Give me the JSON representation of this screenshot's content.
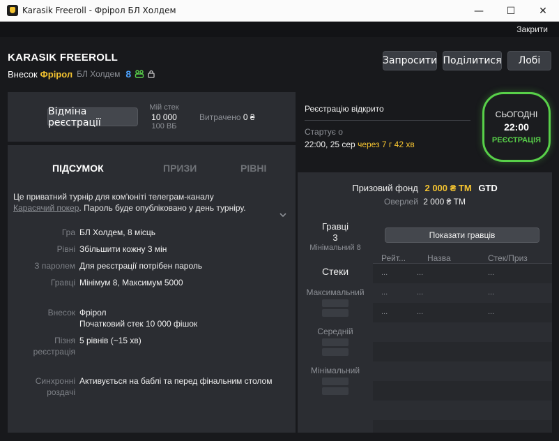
{
  "window": {
    "title": "Karasik Freeroll - Фрірол БЛ Холдем",
    "minimize": "—",
    "maximize": "☐",
    "close": "✕"
  },
  "closebar": {
    "label": "Закрити"
  },
  "header": {
    "title": "KARASIK FREEROLL",
    "buyin_label": "Внесок",
    "buyin_value": "Фрірол",
    "game": "БЛ Холдем",
    "players_count": "8",
    "buttons": {
      "invite": "Запросити",
      "share": "Поділитися",
      "lobby": "Лобі"
    }
  },
  "registration": {
    "cancel_button": "Відміна реєстрації",
    "my_stack_label": "Мій стек",
    "my_stack_value": "10 000",
    "my_stack_bb": "100 ВБ",
    "spent_label": "Витрачено",
    "spent_value": "0 ₴"
  },
  "summary": {
    "tabs": [
      "ПІДСУМОК",
      "ПРИЗИ",
      "РІВНІ"
    ],
    "desc_1": "Це приватний турнір для ком'юніті телеграм-каналу",
    "desc_link": "Карасячий покер",
    "desc_2": ". Пароль буде опубліковано у день турніру.",
    "rows": [
      {
        "key": "Гра",
        "value": "БЛ Холдем, 8 місць"
      },
      {
        "key": "Рівні",
        "value": "Збільшити кожну 3 мін"
      },
      {
        "key": "З паролем",
        "value": "Для реєстрації потрібен пароль"
      },
      {
        "key": "Гравці",
        "value": "Мінімум 8, Максимум 5000"
      },
      {
        "key": "Внесок",
        "value": "Фрірол",
        "value2": "Початковий стек 10 000 фішок"
      },
      {
        "key": "Пізня",
        "key2": "реєстрація",
        "value": "5 рівнів (~15 хв)"
      },
      {
        "key": "Синхронні",
        "key2": "роздачі",
        "value": "Активується на баблі та перед фінальним столом"
      }
    ]
  },
  "status": {
    "reg_open": "Реєстрацію відкрито",
    "starts_label": "Стартує о",
    "start_date": "22:00, 25 сер",
    "start_in": "через 7 г 42 хв",
    "badge_day": "СЬОГОДНІ",
    "badge_time": "22:00",
    "badge_state": "РЕЄСТРАЦІЯ"
  },
  "prize": {
    "fund_label": "Призовий фонд",
    "fund_value": "2 000 ₴ TM",
    "gtd": "GTD",
    "overlay_label": "Оверлей",
    "overlay_value": "2 000 ₴ TM",
    "players_label": "Гравці",
    "players_value": "3",
    "players_min": "Мінімальний 8",
    "stacks_label": "Стеки",
    "stack_max": "Максимальний",
    "stack_avg": "Середній",
    "stack_min": "Мінімальний",
    "show_players": "Показати гравців",
    "columns": [
      "Рейт...",
      "Назва",
      "Стек/Приз"
    ],
    "rows": [
      [
        "...",
        "...",
        "..."
      ],
      [
        "...",
        "...",
        "..."
      ],
      [
        "...",
        "...",
        "..."
      ]
    ]
  }
}
